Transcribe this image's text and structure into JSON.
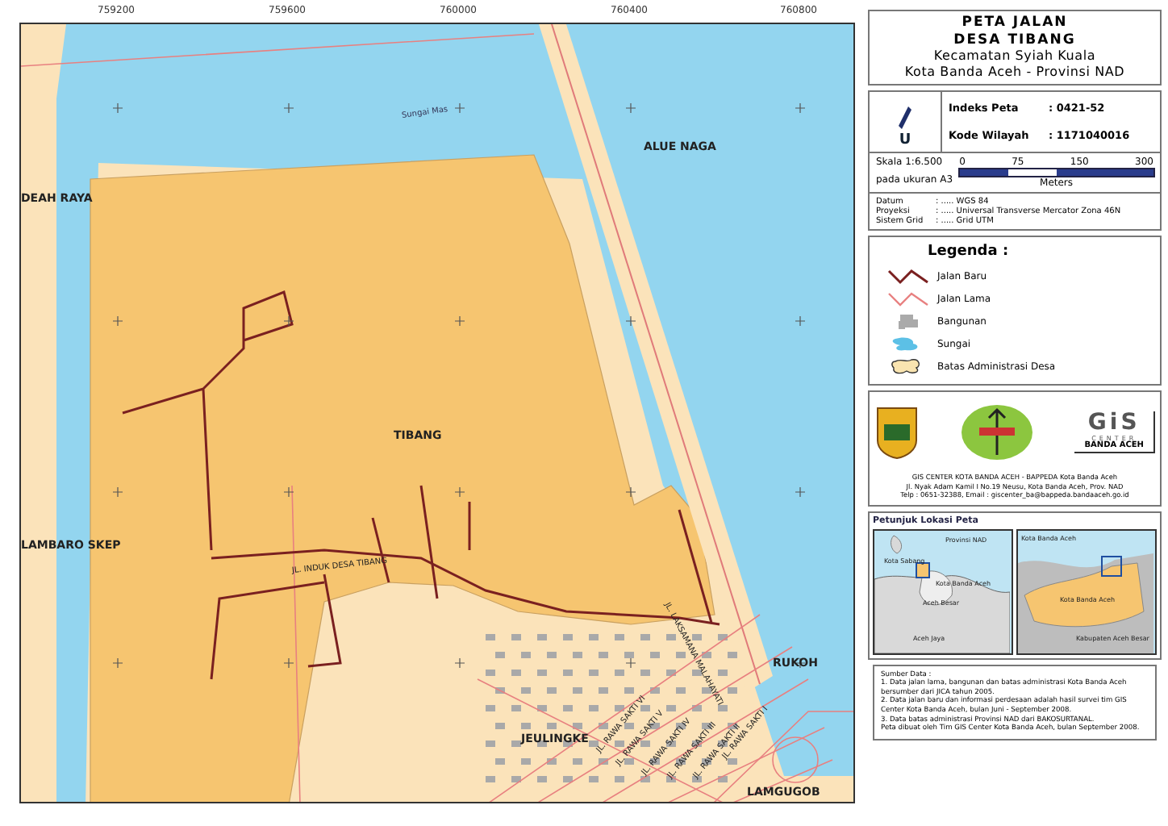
{
  "map": {
    "x_ticks": [
      "759200",
      "759600",
      "760000",
      "760400",
      "760800"
    ],
    "places": [
      {
        "label": "DEAH RAYA",
        "kind": "village"
      },
      {
        "label": "ALUE NAGA",
        "kind": "village"
      },
      {
        "label": "TIBANG",
        "kind": "village"
      },
      {
        "label": "LAMBARO SKEP",
        "kind": "village"
      },
      {
        "label": "JEULINGKE",
        "kind": "village"
      },
      {
        "label": "RUKOH",
        "kind": "village"
      },
      {
        "label": "LAMGUGOB",
        "kind": "village"
      },
      {
        "label": "Sungai Mas",
        "kind": "river"
      },
      {
        "label": "JL. INDUK DESA TIBANG",
        "kind": "road"
      },
      {
        "label": "JL. LAKSAMANA MALAHAYATI",
        "kind": "road"
      },
      {
        "label": "JL. RAWA SAKTI VI",
        "kind": "road"
      },
      {
        "label": "JL. RAWA SAKTI V",
        "kind": "road"
      },
      {
        "label": "JL. RAWA SAKTI IV",
        "kind": "road"
      },
      {
        "label": "JL. RAWA SAKTI III",
        "kind": "road"
      },
      {
        "label": "JL. RAWA SAKTI II",
        "kind": "road"
      },
      {
        "label": "JL. RAWA SAKTI I",
        "kind": "road"
      }
    ]
  },
  "title": {
    "lines": [
      "PETA JALAN",
      "DESA TIBANG"
    ],
    "subtitle": [
      "Kecamatan Syiah Kuala",
      "Kota Banda Aceh - Provinsi NAD"
    ]
  },
  "info": {
    "north": "U",
    "fields": [
      {
        "label": "Indeks Peta",
        "value": ": 0421-52"
      },
      {
        "label": "Kode Wilayah",
        "value": ": 1171040016"
      }
    ],
    "scale": {
      "label": "Skala 1:6.500",
      "paper": "pada ukuran A3",
      "ticks": [
        "0",
        "75",
        "150",
        "300"
      ],
      "unit": "Meters"
    },
    "projection": [
      {
        "label": "Datum",
        "value": ": ..... WGS 84"
      },
      {
        "label": "Proyeksi",
        "value": ": ..... Universal Transverse Mercator Zona 46N"
      },
      {
        "label": "Sistem Grid",
        "value": ": ..... Grid UTM"
      }
    ]
  },
  "legend": {
    "title": "Legenda :",
    "items": [
      {
        "label": "Jalan Baru",
        "kind": "new-road"
      },
      {
        "label": "Jalan Lama",
        "kind": "old-road"
      },
      {
        "label": "Bangunan",
        "kind": "building"
      },
      {
        "label": "Sungai",
        "kind": "river"
      },
      {
        "label": "Batas Administrasi Desa",
        "kind": "boundary"
      }
    ]
  },
  "logos": {
    "gis": [
      "GiS",
      "CENTER",
      "BANDA ACEH"
    ],
    "address": [
      "GIS CENTER KOTA BANDA ACEH - BAPPEDA Kota Banda Aceh",
      "Jl. Nyak Adam Kamil I No.19 Neusu, Kota Banda Aceh, Prov. NAD",
      "Telp : 0651-32388, Email : giscenter_ba@bappeda.bandaaceh.go.id"
    ]
  },
  "location": {
    "title": "Petunjuk Lokasi Peta",
    "left_labels": [
      "Provinsi NAD",
      "Kota Sabang",
      "Kota Banda Aceh",
      "Aceh Besar",
      "Aceh Jaya"
    ],
    "right_labels": [
      "Kota Banda Aceh",
      "Kota Banda Aceh",
      "Kabupaten Aceh Besar"
    ]
  },
  "sources": {
    "title": "Sumber Data :",
    "items": [
      "1. Data jalan lama, bangunan dan batas administrasi Kota Banda Aceh bersumber dari JICA tahun 2005.",
      "2. Data jalan baru dan informasi perdesaan adalah hasil survei tim GIS Center Kota Banda Aceh, bulan Juni - September 2008.",
      "3. Data batas administrasi Provinsi NAD dari BAKOSURTANAL."
    ],
    "footer": "Peta dibuat oleh Tim GIS Center Kota Banda Aceh, bulan September 2008."
  }
}
